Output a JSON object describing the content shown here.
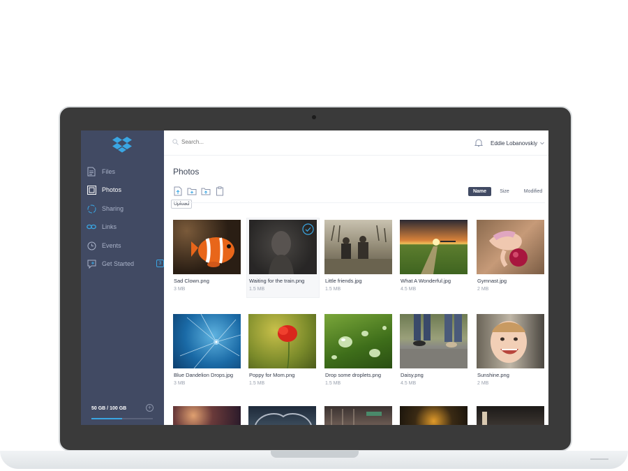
{
  "sidebar": {
    "items": [
      {
        "label": "Files",
        "icon": "file-icon"
      },
      {
        "label": "Photos",
        "icon": "photo-icon",
        "active": true
      },
      {
        "label": "Sharing",
        "icon": "sharing-icon"
      },
      {
        "label": "Links",
        "icon": "link-icon"
      },
      {
        "label": "Events",
        "icon": "clock-icon"
      },
      {
        "label": "Get Started",
        "icon": "get-started-icon",
        "badge": "3"
      }
    ],
    "storage": {
      "label": "50 GB / 100 GB",
      "used_fraction": 0.5
    }
  },
  "header": {
    "search_placeholder": "Search...",
    "user_name": "Eddie Lobanovskiy"
  },
  "main": {
    "title": "Photos",
    "tooltip": "Upload",
    "sort": [
      {
        "label": "Name",
        "active": true
      },
      {
        "label": "Size"
      },
      {
        "label": "Modified"
      }
    ],
    "photos": [
      {
        "name": "Sad Clown.png",
        "size": "3 MB"
      },
      {
        "name": "Waiting for the train.png",
        "size": "1.5 MB",
        "selected": true
      },
      {
        "name": "Little friends.jpg",
        "size": "1.5 MB"
      },
      {
        "name": "What A Wonderful.jpg",
        "size": "4.5 MB"
      },
      {
        "name": "Gymnast.jpg",
        "size": "2 MB"
      },
      {
        "name": "Blue Dandelion Drops.jpg",
        "size": "3 MB"
      },
      {
        "name": "Poppy for Mom.png",
        "size": "1.5 MB"
      },
      {
        "name": "Drop some droplets.png",
        "size": "1.5 MB"
      },
      {
        "name": "Daisy.png",
        "size": "4.5 MB"
      },
      {
        "name": "Sunshine.png",
        "size": "2 MB"
      }
    ]
  },
  "colors": {
    "sidebar_bg": "#414a63",
    "accent": "#3aa6e3",
    "sort_active_bg": "#414a63"
  }
}
